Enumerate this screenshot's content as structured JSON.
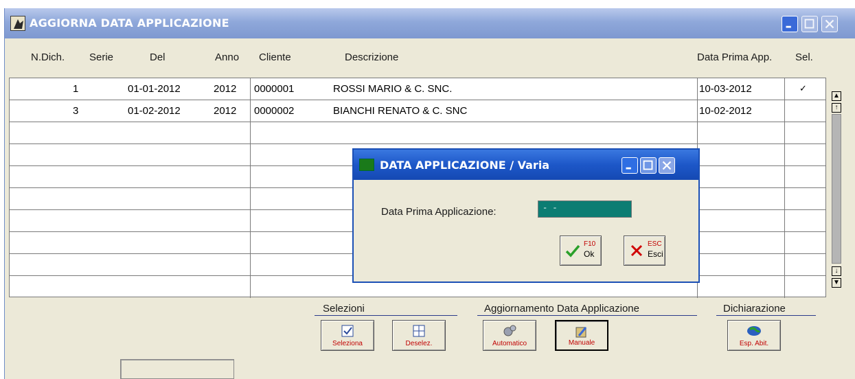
{
  "window": {
    "title": "AGGIORNA DATA APPLICAZIONE"
  },
  "table": {
    "headers": {
      "ndich": "N.Dich.",
      "serie": "Serie",
      "del": "Del",
      "anno": "Anno",
      "cliente": "Cliente",
      "descrizione": "Descrizione",
      "data_prima": "Data Prima App.",
      "sel": "Sel."
    },
    "rows": [
      {
        "ndich": "1",
        "del": "01-01-2012",
        "anno": "2012",
        "cliente": "0000001",
        "descrizione": "ROSSI MARIO & C. SNC.",
        "data_prima": "10-03-2012",
        "sel": "✓"
      },
      {
        "ndich": "3",
        "del": "01-02-2012",
        "anno": "2012",
        "cliente": "0000002",
        "descrizione": "BIANCHI RENATO & C. SNC",
        "data_prima": "10-02-2012",
        "sel": ""
      }
    ]
  },
  "groups": {
    "selezioni": "Selezioni",
    "aggiornamento": "Aggiornamento Data Applicazione",
    "dichiarazione": "Dichiarazione"
  },
  "buttons": {
    "seleziona": "Seleziona",
    "deselez": "Deselez.",
    "automatico": "Automatico",
    "manuale": "Manuale",
    "esp_abit": "Esp. Abit."
  },
  "dialog": {
    "title": "DATA APPLICAZIONE / Varia",
    "field_label": "Data Prima Applicazione:",
    "field_value": "- -",
    "ok_key": "F10",
    "ok_label": "Ok",
    "esc_key": "ESC",
    "esc_label": "Esci"
  },
  "colors": {
    "title_gradient_top": "#b9c9ec",
    "dialog_title": "#1d57c8",
    "input_bg": "#0c7d73",
    "button_label": "#c00000"
  }
}
